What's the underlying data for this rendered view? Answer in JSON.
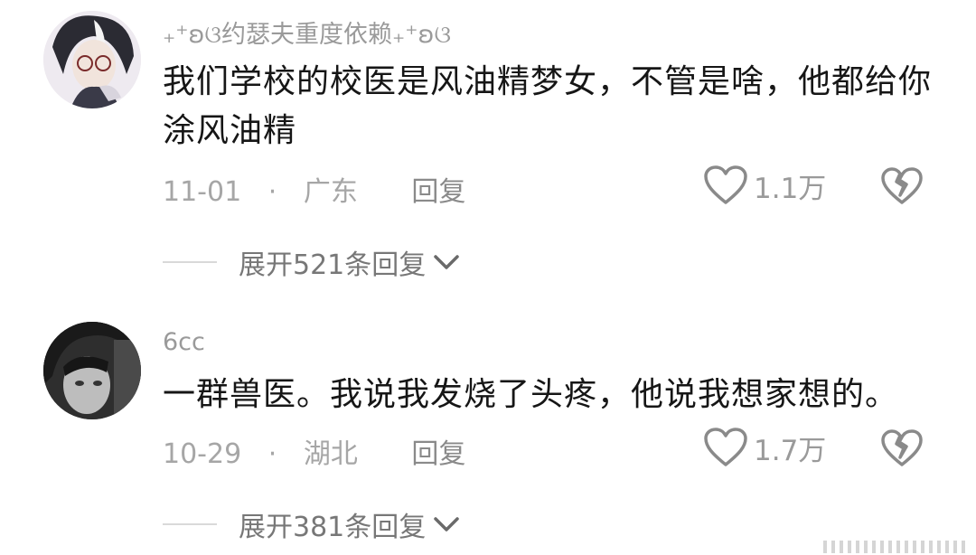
{
  "comments": [
    {
      "username": "₊⁺ʚଓ约瑟夫重度依赖₊⁺ʚଓ",
      "text": "我们学校的校医是风油精梦女，不管是啥，他都给你涂风油精",
      "date": "11-01",
      "separator": "·",
      "location": "广东",
      "reply_label": "回复",
      "like_count": "1.1万",
      "expand_label": "展开521条回复",
      "avatar_color": "#6b6b78"
    },
    {
      "username": "6cc",
      "text": "一群兽医。我说我发烧了头疼，他说我想家想的。",
      "date": "10-29",
      "separator": "·",
      "location": "湖北",
      "reply_label": "回复",
      "like_count": "1.7万",
      "expand_label": "展开381条回复",
      "avatar_color": "#3a3a3a"
    }
  ],
  "icons": {
    "like": "heart-outline-icon",
    "dislike": "broken-heart-icon",
    "expand": "chevron-down-icon"
  }
}
